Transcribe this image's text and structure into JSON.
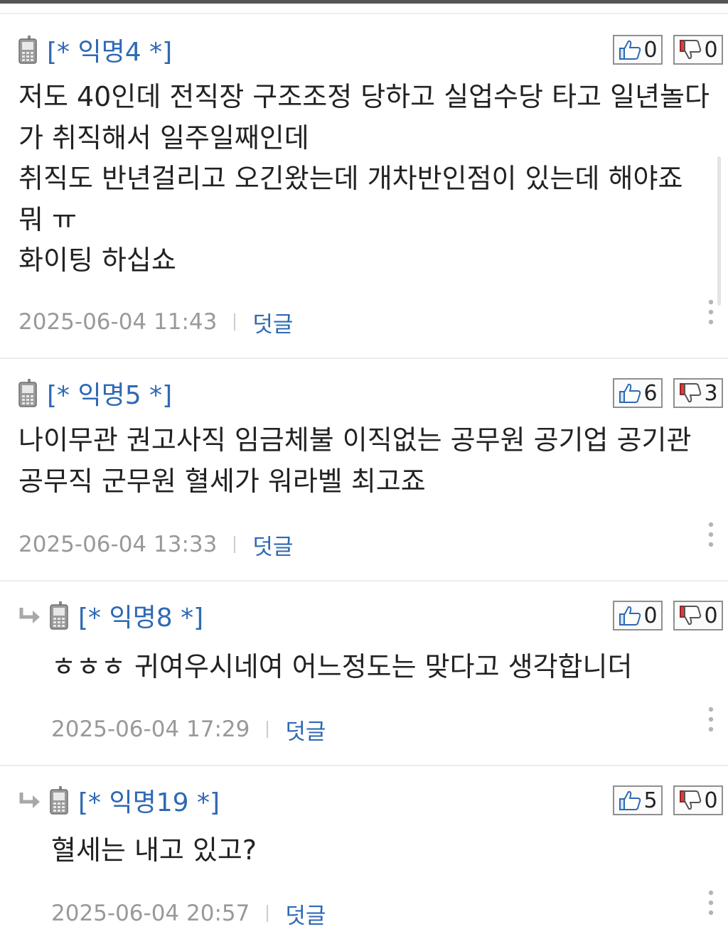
{
  "comments": [
    {
      "author": "[* 익명4 *]",
      "likes": "0",
      "dislikes": "0",
      "lines": [
        "저도 40인데 전직장 구조조정 당하고 실업수당 타고 일년놀다",
        "가 취직해서 일주일째인데",
        "취직도 반년걸리고 오긴왔는데 개차반인점이 있는데 해야죠",
        "뭐 ㅠ",
        "화이팅 하십쇼"
      ],
      "date": "2025-06-04 11:43",
      "reply_label": "덧글",
      "is_reply": false
    },
    {
      "author": "[* 익명5 *]",
      "likes": "6",
      "dislikes": "3",
      "lines": [
        "나이무관 권고사직 임금체불 이직없는 공무원 공기업 공기관",
        "공무직 군무원 혈세가 워라벨 최고죠"
      ],
      "date": "2025-06-04 13:33",
      "reply_label": "덧글",
      "is_reply": false
    },
    {
      "author": "[* 익명8 *]",
      "likes": "0",
      "dislikes": "0",
      "lines": [
        "ㅎㅎㅎ 귀여우시네여 어느정도는 맞다고 생각합니더"
      ],
      "date": "2025-06-04 17:29",
      "reply_label": "덧글",
      "is_reply": true
    },
    {
      "author": "[* 익명19 *]",
      "likes": "5",
      "dislikes": "0",
      "lines": [
        "혈세는 내고 있고?"
      ],
      "date": "2025-06-04 20:57",
      "reply_label": "덧글",
      "is_reply": true
    }
  ]
}
